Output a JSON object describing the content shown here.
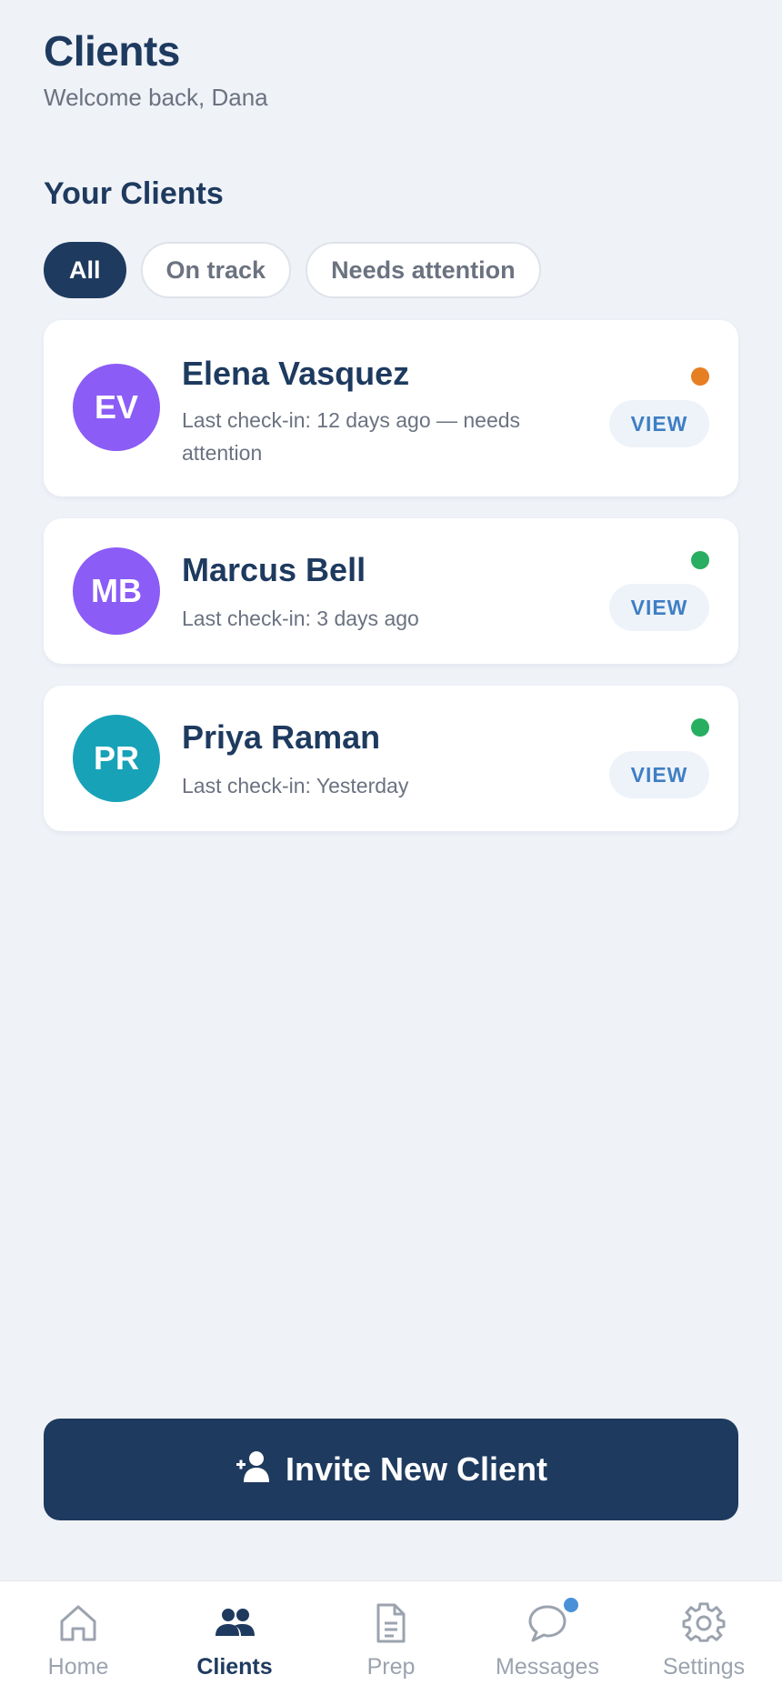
{
  "header": {
    "title": "Clients",
    "subtitle": "Welcome back, Dana"
  },
  "section_title": "Your Clients",
  "filters": [
    {
      "label": "All",
      "active": true
    },
    {
      "label": "On track",
      "active": false
    },
    {
      "label": "Needs attention",
      "active": false
    }
  ],
  "clients": [
    {
      "initials": "EV",
      "name": "Elena Vasquez",
      "checkin": "Last check-in: 12 days ago — needs attention",
      "status": "needs-attention",
      "avatar_color": "#8b5cf6",
      "status_color": "#e67e22",
      "action": "VIEW"
    },
    {
      "initials": "MB",
      "name": "Marcus Bell",
      "checkin": "Last check-in: 3 days ago",
      "status": "on-track",
      "avatar_color": "#8b5cf6",
      "status_color": "#27ae60",
      "action": "VIEW"
    },
    {
      "initials": "PR",
      "name": "Priya Raman",
      "checkin": "Last check-in: Yesterday",
      "status": "on-track",
      "avatar_color": "#17a2b8",
      "status_color": "#27ae60",
      "action": "VIEW"
    }
  ],
  "invite_button": {
    "label": "Invite New Client",
    "icon": "add-user-icon"
  },
  "nav": [
    {
      "label": "Home",
      "icon": "home-icon",
      "active": false
    },
    {
      "label": "Clients",
      "icon": "users-icon",
      "active": true
    },
    {
      "label": "Prep",
      "icon": "document-icon",
      "active": false
    },
    {
      "label": "Messages",
      "icon": "chat-icon",
      "active": false,
      "badge": true
    },
    {
      "label": "Settings",
      "icon": "gear-icon",
      "active": false
    }
  ],
  "colors": {
    "primary": "#1e3a5f",
    "accent": "#3f7fc4",
    "background": "#eff2f7"
  }
}
